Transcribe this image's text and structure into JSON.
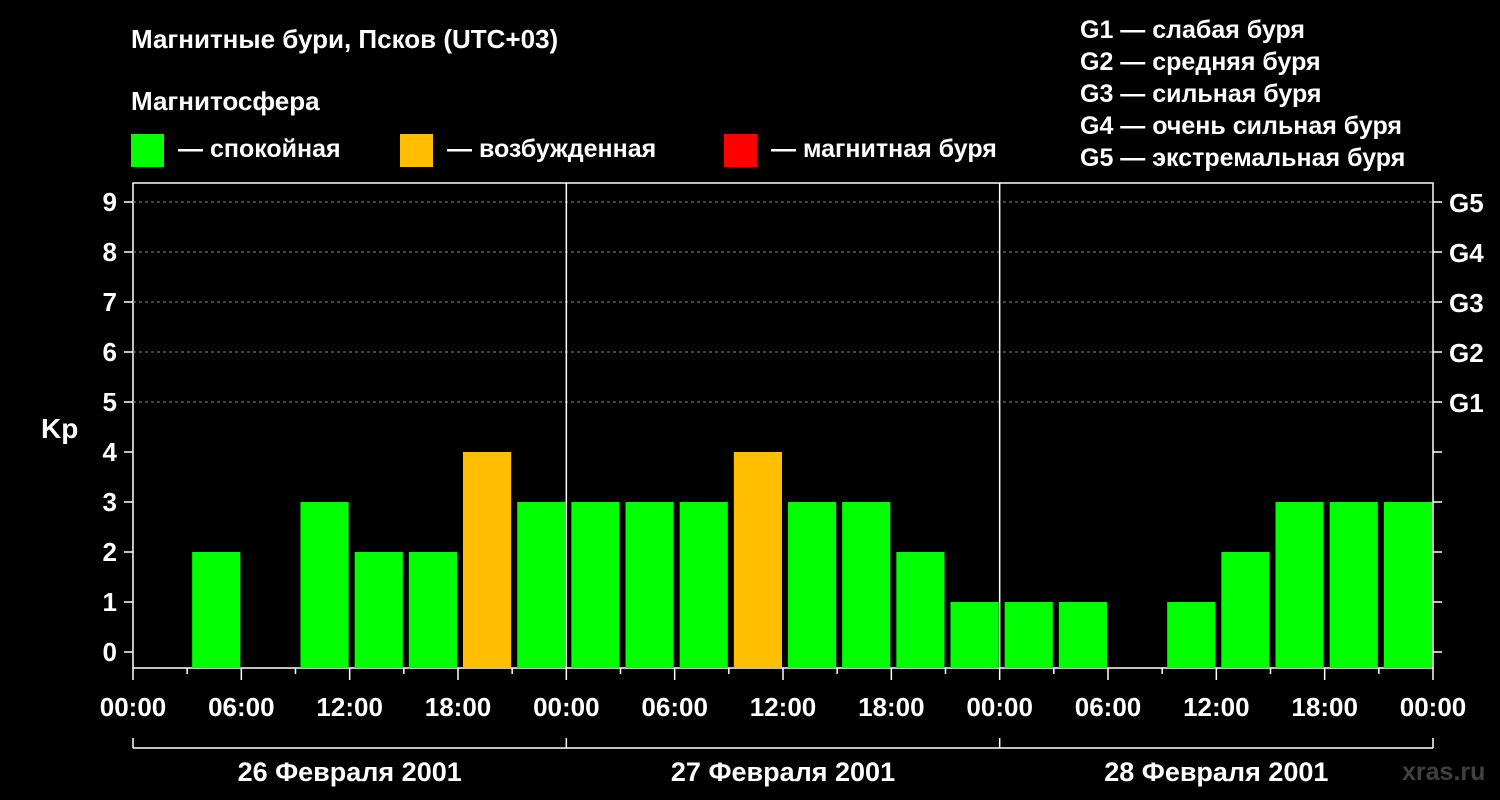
{
  "chart_data": {
    "type": "bar",
    "title": "Магнитные бури, Псков (UTC+03)",
    "subtitle": "Магнитосфера",
    "ylabel": "Kp",
    "ylim": [
      0,
      9
    ],
    "yticks": [
      "0",
      "1",
      "2",
      "3",
      "4",
      "5",
      "6",
      "7",
      "8",
      "9"
    ],
    "g_ticks": [
      {
        "kp": 5,
        "label": "G1"
      },
      {
        "kp": 6,
        "label": "G2"
      },
      {
        "kp": 7,
        "label": "G3"
      },
      {
        "kp": 8,
        "label": "G4"
      },
      {
        "kp": 9,
        "label": "G5"
      }
    ],
    "xtick_labels": [
      "00:00",
      "06:00",
      "12:00",
      "18:00",
      "00:00",
      "06:00",
      "12:00",
      "18:00",
      "00:00",
      "06:00",
      "12:00",
      "18:00",
      "00:00"
    ],
    "days": [
      "26 Февраля 2001",
      "27 Февраля 2001",
      "28 Февраля 2001"
    ],
    "interval_hours": 3,
    "values": [
      0,
      2,
      0,
      3,
      2,
      2,
      4,
      3,
      3,
      3,
      3,
      4,
      3,
      3,
      2,
      1,
      1,
      1,
      0,
      1,
      2,
      3,
      3,
      3
    ],
    "status": [
      "calm",
      "calm",
      "calm",
      "calm",
      "calm",
      "calm",
      "excited",
      "calm",
      "calm",
      "calm",
      "calm",
      "excited",
      "calm",
      "calm",
      "calm",
      "calm",
      "calm",
      "calm",
      "calm",
      "calm",
      "calm",
      "calm",
      "calm",
      "calm"
    ],
    "legend": [
      {
        "key": "calm",
        "label": "— спокойная",
        "color": "#00ff00"
      },
      {
        "key": "excited",
        "label": "— возбужденная",
        "color": "#ffbf00"
      },
      {
        "key": "storm",
        "label": "— магнитная буря",
        "color": "#ff0000"
      }
    ],
    "g_legend": [
      "G1 — слабая буря",
      "G2 — средняя буря",
      "G3 — сильная буря",
      "G4 — очень сильная буря",
      "G5 — экстремальная буря"
    ],
    "grid": true
  },
  "watermark": "xras.ru"
}
